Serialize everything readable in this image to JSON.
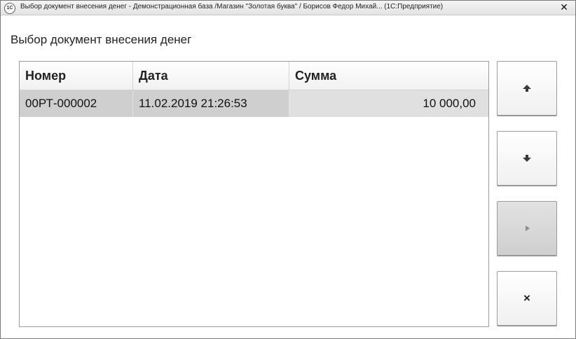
{
  "window": {
    "title": "Выбор документ внесения денег - Демонстрационная база /Магазин \"Золотая буква\" / Борисов Федор Михай... (1С:Предприятие)",
    "icon_label": "1С",
    "close_icon": "close-icon"
  },
  "form": {
    "title": "Выбор документ внесения денег"
  },
  "table": {
    "columns": [
      "Номер",
      "Дата",
      "Сумма"
    ],
    "rows": [
      {
        "number": "00РТ-000002",
        "date": "11.02.2019 21:26:53",
        "amount": "10 000,00"
      }
    ]
  },
  "buttons": {
    "up": {
      "icon": "arrow-up-icon"
    },
    "down": {
      "icon": "arrow-down-icon"
    },
    "select": {
      "icon": "play-icon",
      "state": "disabled"
    },
    "close": {
      "icon": "close-icon",
      "glyph": "×"
    }
  }
}
